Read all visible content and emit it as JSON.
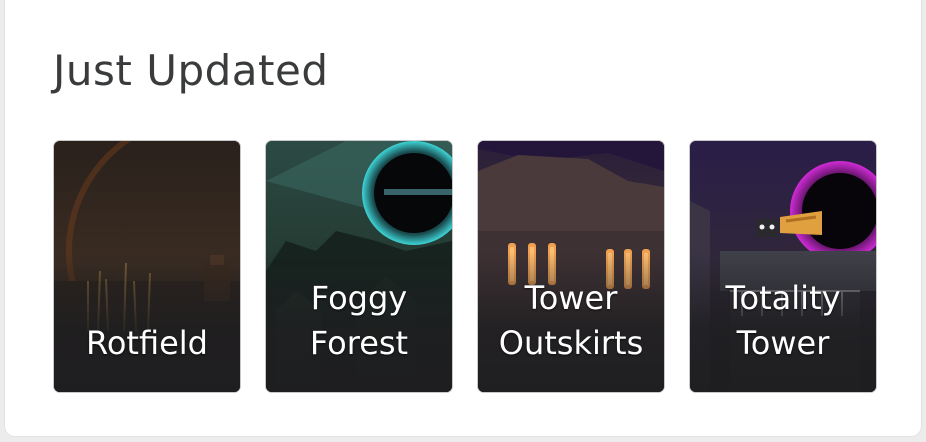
{
  "section": {
    "title": "Just Updated"
  },
  "cards": [
    {
      "lines": [
        "Rotfield"
      ],
      "icon": "rotfield-thumbnail"
    },
    {
      "lines": [
        "Foggy",
        "Forest"
      ],
      "icon": "foggy-forest-thumbnail"
    },
    {
      "lines": [
        "Tower",
        "Outskirts"
      ],
      "icon": "tower-outskirts-thumbnail"
    },
    {
      "lines": [
        "Totality",
        "Tower"
      ],
      "icon": "totality-tower-thumbnail"
    }
  ],
  "colors": {
    "title": "#393b3d",
    "card_background": "#1f1f21",
    "card_label": "#ffffff",
    "portal_cyan": "#3fd6d8",
    "portal_magenta": "#d12bd6",
    "window_glow": "#f0a050"
  }
}
